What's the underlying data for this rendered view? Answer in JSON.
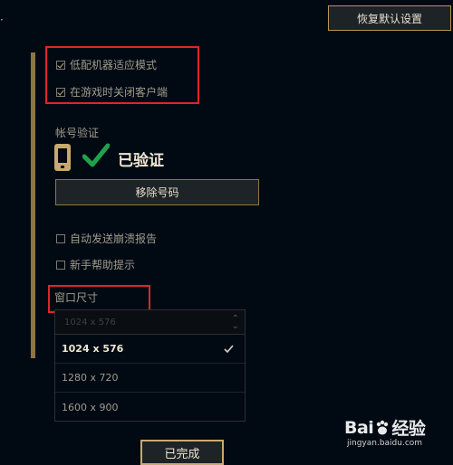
{
  "header": {
    "restore_defaults_label": "恢复默认设置"
  },
  "options": {
    "low_spec_mode": {
      "label": "低配机器适应模式",
      "checked": true
    },
    "close_client_in_game": {
      "label": "在游戏时关闭客户端",
      "checked": true
    },
    "auto_send_crash_report": {
      "label": "自动发送崩溃报告",
      "checked": false
    },
    "newbie_tips": {
      "label": "新手帮助提示",
      "checked": false
    }
  },
  "account": {
    "section_label": "帐号验证",
    "status_text": "已验证",
    "remove_button_label": "移除号码"
  },
  "window_size": {
    "section_label": "窗口尺寸",
    "current_value": "1024 x 576",
    "options": [
      {
        "label": "1024 x 576",
        "selected": true
      },
      {
        "label": "1280 x 720",
        "selected": false
      },
      {
        "label": "1600 x 900",
        "selected": false
      }
    ]
  },
  "footer": {
    "done_button_label": "已完成"
  },
  "watermark": {
    "logo_text_left": "Bai",
    "logo_text_right": "经验",
    "url": "jingyan.baidu.com"
  },
  "colors": {
    "background": "#010a13",
    "gold_accent": "#c8aa6e",
    "highlight_red": "#e0262a",
    "verified_green": "#1fa24a"
  }
}
